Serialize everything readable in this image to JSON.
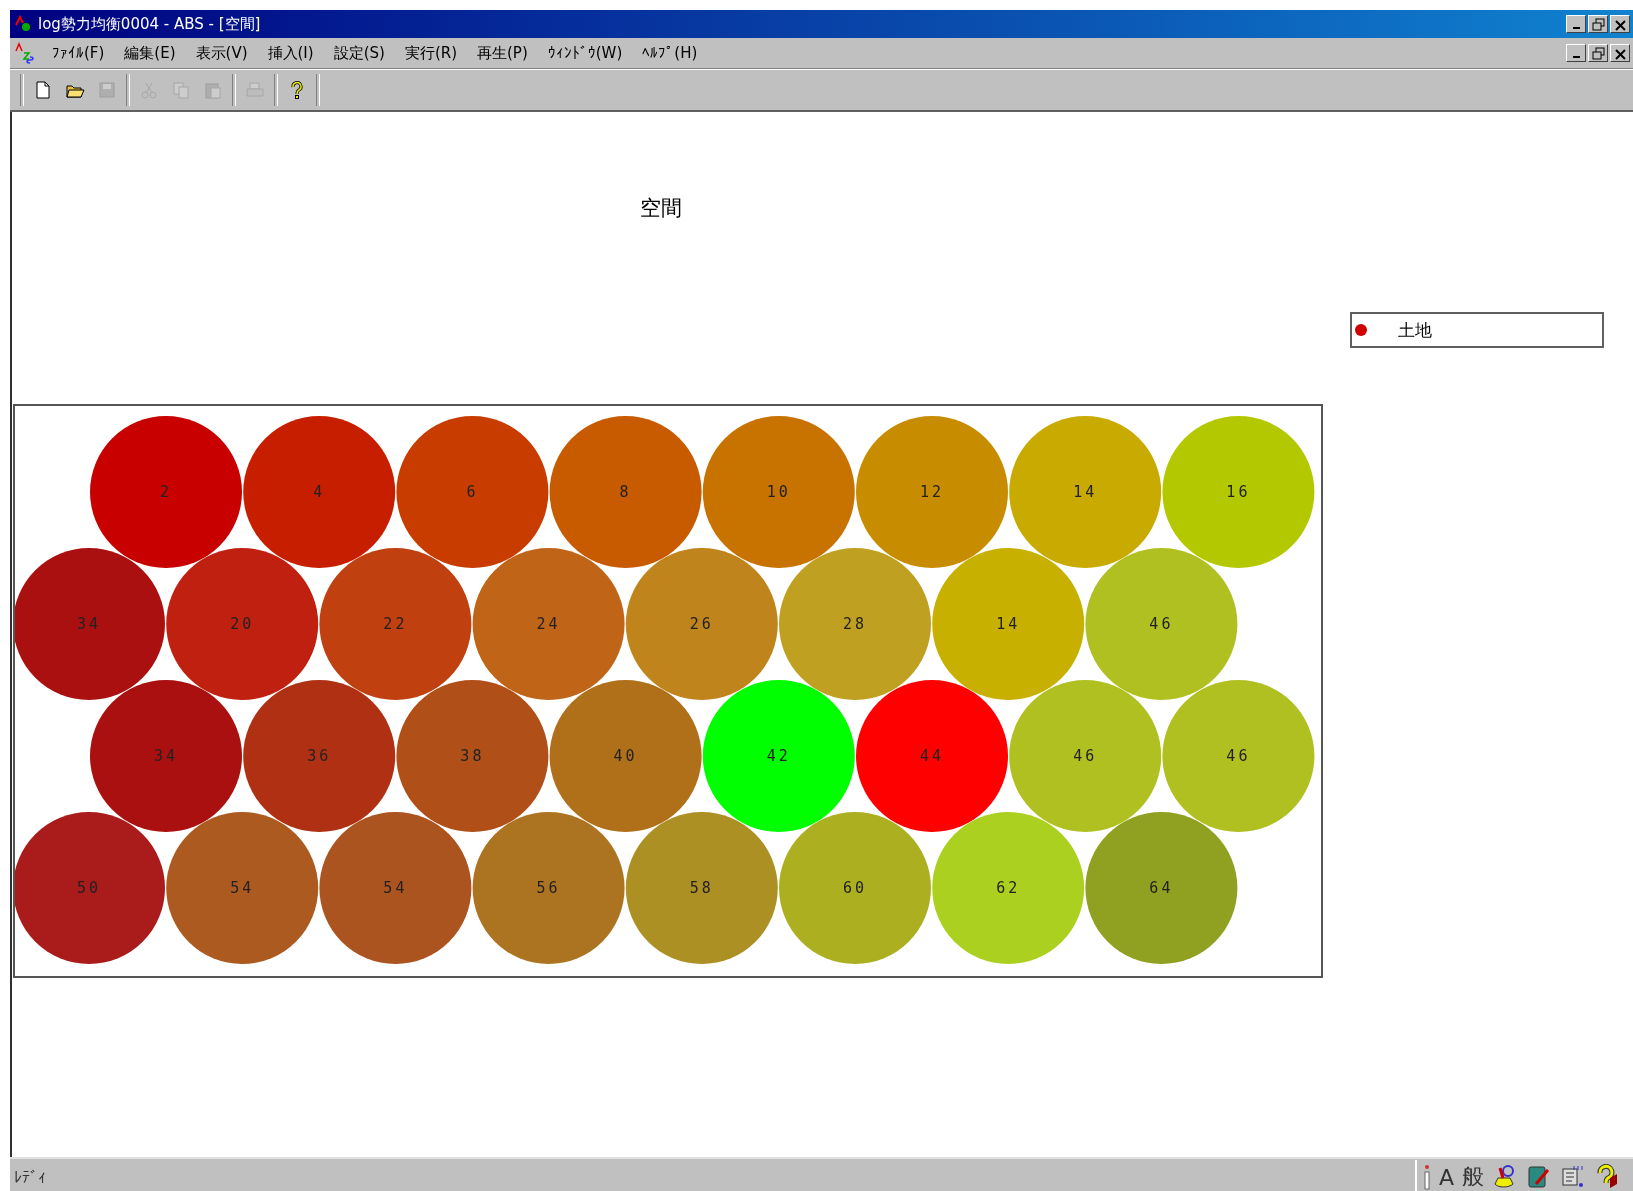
{
  "window": {
    "title": "log勢力均衡0004 - ABS - [空間]"
  },
  "menu": [
    "ﾌｧｲﾙ(F)",
    "編集(E)",
    "表示(V)",
    "挿入(I)",
    "設定(S)",
    "実行(R)",
    "再生(P)",
    "ｳｨﾝﾄﾞｳ(W)",
    "ﾍﾙﾌﾟ(H)"
  ],
  "toolbar": [
    {
      "kind": "new",
      "disabled": false
    },
    {
      "kind": "open",
      "disabled": false
    },
    {
      "kind": "save",
      "disabled": true
    },
    {
      "kind": "sep"
    },
    {
      "kind": "cut",
      "disabled": true
    },
    {
      "kind": "copy",
      "disabled": true
    },
    {
      "kind": "paste",
      "disabled": true
    },
    {
      "kind": "sep"
    },
    {
      "kind": "print",
      "disabled": true
    },
    {
      "kind": "sep"
    },
    {
      "kind": "help",
      "disabled": false
    }
  ],
  "view": {
    "title": "空間",
    "legend": [
      {
        "label": "土地",
        "color": "#d00000"
      }
    ],
    "rows": [
      [
        {
          "label": "2",
          "color": "#c80000"
        },
        {
          "label": "4",
          "color": "#c81e00"
        },
        {
          "label": "6",
          "color": "#c83c00"
        },
        {
          "label": "8",
          "color": "#c85a00"
        },
        {
          "label": "10",
          "color": "#c87200"
        },
        {
          "label": "12",
          "color": "#c88c00"
        },
        {
          "label": "14",
          "color": "#c8aa00"
        },
        {
          "label": "16",
          "color": "#b4c800"
        }
      ],
      [
        {
          "label": "34",
          "color": "#aa1010"
        },
        {
          "label": "20",
          "color": "#c02010"
        },
        {
          "label": "22",
          "color": "#c04010"
        },
        {
          "label": "24",
          "color": "#c06418"
        },
        {
          "label": "26",
          "color": "#c0841c"
        },
        {
          "label": "28",
          "color": "#c0a020"
        },
        {
          "label": "14",
          "color": "#c8b000"
        },
        {
          "label": "46",
          "color": "#b0c020"
        }
      ],
      [
        {
          "label": "34",
          "color": "#aa1010"
        },
        {
          "label": "36",
          "color": "#b03014"
        },
        {
          "label": "38",
          "color": "#b05018"
        },
        {
          "label": "40",
          "color": "#b0701a"
        },
        {
          "label": "42",
          "color": "#00ff00"
        },
        {
          "label": "44",
          "color": "#ff0000"
        },
        {
          "label": "46",
          "color": "#b0c020"
        },
        {
          "label": "46",
          "color": "#b0c020"
        }
      ],
      [
        {
          "label": "50",
          "color": "#aa1c1c"
        },
        {
          "label": "54",
          "color": "#ac5a20"
        },
        {
          "label": "54",
          "color": "#ac5420"
        },
        {
          "label": "56",
          "color": "#ac7420"
        },
        {
          "label": "58",
          "color": "#ac9024"
        },
        {
          "label": "60",
          "color": "#acb020"
        },
        {
          "label": "62",
          "color": "#acd020"
        },
        {
          "label": "64",
          "color": "#90a020"
        }
      ]
    ]
  },
  "status_bar": {
    "text": "ﾚﾃﾞｨ",
    "tray": [
      "A",
      "般"
    ]
  }
}
